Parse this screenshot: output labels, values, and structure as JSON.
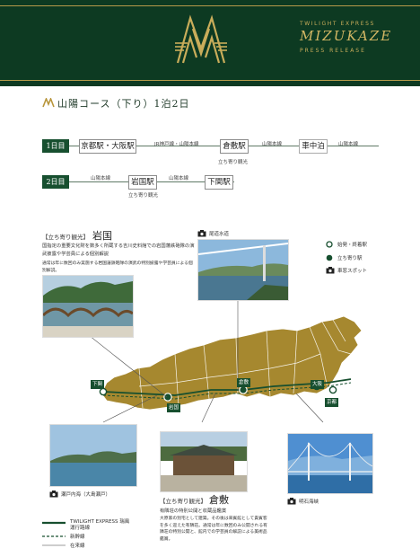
{
  "header": {
    "brand_line1": "TWILIGHT EXPRESS",
    "brand_line2": "MIZUKAZE",
    "brand_line3": "PRESS RELEASE",
    "bg_color": "#0d3a22",
    "gold_color": "#c9ad5a"
  },
  "course_title": "山陽コース（下り）1泊2日",
  "itinerary": {
    "day1": {
      "label": "1日目",
      "start_station": "京都駅・大阪駅",
      "seg1": "JR神戸線・山陽本線",
      "stop1": "倉敷駅",
      "stop1_note": "立ち寄り観光",
      "seg2": "山陽本線",
      "overnight": "車中泊",
      "seg3": "山陽本線"
    },
    "day2": {
      "label": "2日目",
      "seg1": "山陽本線",
      "stop1": "岩国駅",
      "stop1_note": "立ち寄り観光",
      "seg2": "山陽本線",
      "end_station": "下関駅"
    }
  },
  "iwakuni": {
    "section_label": "立ち寄り観光",
    "city": "岩国",
    "description": "国指定の重要文化財を数多く所蔵する吉川史料館での岩国藩鉄砲隊の演武披露や学芸員による個別解説",
    "note": "通常は年に数回のみ実施する岩国藩鉄砲隊の演武の特別披露や学芸員による個別解説。"
  },
  "kurashiki": {
    "section_label": "立ち寄り観光",
    "city": "倉敷",
    "description": "有隣荘の特別公開と収蔵品鑑賞",
    "note": "大原家の別宅として建築。その後は来賓館として貴賓客を多く迎えた有隣荘。通常は年に数回のみ公開される有隣荘の特別公開と、館内での学芸員の解説による美術品鑑賞。"
  },
  "photo_captions": {
    "onomichi": "尾道水道",
    "setouchi": "瀬戸内海（大島瀬戸）",
    "akashi": "明石海峡"
  },
  "map_labels": {
    "shimonoseki": "下関",
    "iwakuni": "岩国",
    "kurashiki": "倉敷",
    "osaka": "大阪",
    "kyoto": "京都"
  },
  "legend": {
    "boarding": "始発・終着駅",
    "stopover": "立ち寄り駅",
    "scenic": "車窓スポット"
  },
  "legend_bottom": {
    "route_l1": "TWILIGHT EXPRESS 瑞風",
    "route_l2": "運行路線",
    "shinkansen": "新幹線",
    "conventional": "在来線"
  }
}
